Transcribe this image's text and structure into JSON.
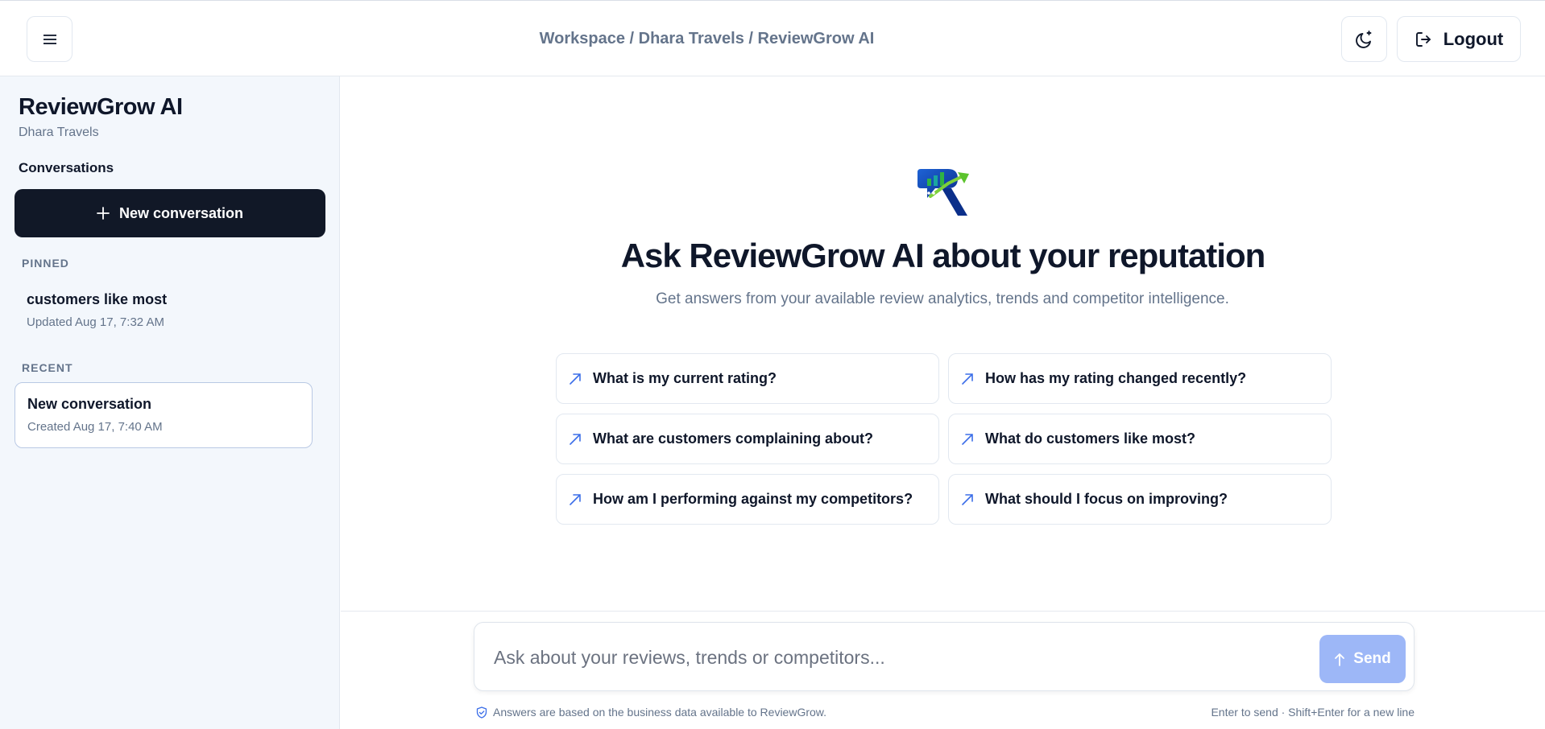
{
  "header": {
    "menu_icon": "menu-icon",
    "breadcrumb": "Workspace / Dhara Travels / ReviewGrow AI",
    "theme_icon": "moon-icon",
    "logout_icon": "logout-icon",
    "logout_label": "Logout"
  },
  "sidebar": {
    "app_name": "ReviewGrow AI",
    "business_name": "Dhara Travels",
    "conversations_heading": "Conversations",
    "new_conversation_label": "New conversation",
    "pinned_label": "PINNED",
    "pinned": [
      {
        "title": "customers like most",
        "time": "Updated Aug 17, 7:32 AM"
      }
    ],
    "recent_label": "RECENT",
    "recent": [
      {
        "title": "New conversation",
        "time": "Created Aug 17, 7:40 AM",
        "active": true
      }
    ]
  },
  "main": {
    "logo_icon": "reviewgrow-logo",
    "title": "Ask ReviewGrow AI about your reputation",
    "subtitle": "Get answers from your available review analytics, trends and competitor intelligence.",
    "suggestions": [
      "What is my current rating?",
      "How has my rating changed recently?",
      "What are customers complaining about?",
      "What do customers like most?",
      "How am I performing against my competitors?",
      "What should I focus on improving?"
    ]
  },
  "composer": {
    "placeholder": "Ask about your reviews, trends or competitors...",
    "value": "",
    "send_label": "Send",
    "footnote": "Answers are based on the business data available to ReviewGrow.",
    "shortcut_hint": "Enter to send · Shift+Enter for a new line"
  },
  "colors": {
    "primary_dark": "#111827",
    "accent_blue": "#3b6ee8",
    "send_disabled": "#9db7f7",
    "sidebar_bg": "#f3f7fc"
  }
}
